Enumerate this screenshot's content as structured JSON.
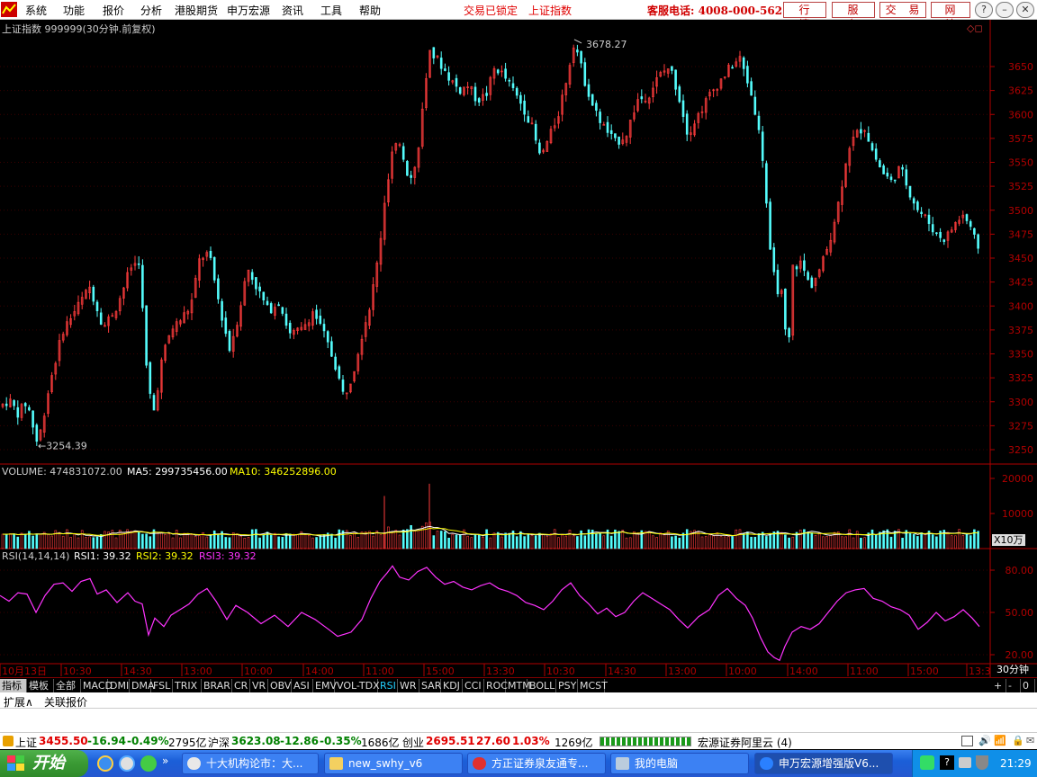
{
  "menu": {
    "items": [
      "系统",
      "功能",
      "报价",
      "分析",
      "港股期货",
      "申万宏源",
      "资讯",
      "工具",
      "帮助"
    ],
    "lock_text": "交易已锁定",
    "index_text": "上证指数",
    "hotline": "客服电话: 4008-000-562",
    "buttons": [
      "行 情",
      "服 务",
      "交 易",
      "网 站"
    ]
  },
  "chart_title": "上证指数 999999(30分钟.前复权)",
  "annotations": {
    "high": "3678.27",
    "low": "3254.39"
  },
  "volume": {
    "label": "VOLUME: 474831072.00",
    "ma5": "MA5: 299735456.00",
    "ma10": "MA10: 346252896.00",
    "unit": "X10万"
  },
  "rsi": {
    "label": "RSI(14,14,14)",
    "rsi1": "RSI1: 39.32",
    "rsi2": "RSI2: 39.32",
    "rsi3": "RSI3: 39.32"
  },
  "period": "30分钟",
  "tabs": [
    "指标",
    "模板",
    "全部",
    "MACD",
    "DMI",
    "DMA",
    "FSL",
    "TRIX",
    "BRAR",
    "CR",
    "VR",
    "OBV",
    "ASI",
    "EMV",
    "VOL-TDX",
    "RSI",
    "WR",
    "SAR",
    "KDJ",
    "CCI",
    "ROC",
    "MTM",
    "BOLL",
    "PSY",
    "MCST"
  ],
  "tab_controls": [
    "+",
    "-",
    "0"
  ],
  "ext_tabs": [
    "扩展∧",
    "关联报价"
  ],
  "status": {
    "sh_label": "上证",
    "sh_val": "3455.50",
    "sh_chg": "-16.94",
    "sh_pct": "-0.49%",
    "sh_amt": "2795亿",
    "hs_label": "沪深",
    "hs_val": "3623.08",
    "hs_chg": "-12.86",
    "hs_pct": "-0.35%",
    "hs_amt": "1686亿",
    "cy_label": "创业",
    "cy_val": "2695.51",
    "cy_chg": "27.60",
    "cy_pct": "1.03%",
    "cy_amt": "1269亿",
    "broker": "宏源证券阿里云 (4)"
  },
  "taskbar": {
    "start": "开始",
    "tasks": [
      "十大机构论市：大...",
      "new_swhy_v6",
      "方正证券泉友通专...",
      "我的电脑",
      "申万宏源增强版V6..."
    ],
    "clock": "21:29"
  },
  "chart_data": {
    "type": "candlestick",
    "title": "上证指数 999999(30分钟.前复权)",
    "x_ticks": [
      "10月13日",
      "10:30",
      "14:30",
      "13:00",
      "10:00",
      "14:00",
      "11:00",
      "15:00",
      "13:30",
      "10:30",
      "14:30",
      "13:00",
      "10:00",
      "14:00",
      "11:00",
      "15:00",
      "13:3"
    ],
    "price_axis": {
      "ticks": [
        3250,
        3275,
        3300,
        3325,
        3350,
        3375,
        3400,
        3425,
        3450,
        3475,
        3500,
        3525,
        3550,
        3575,
        3600,
        3625,
        3650
      ],
      "range": [
        3235,
        3685
      ]
    },
    "volume_axis": {
      "ticks": [
        10000,
        20000
      ],
      "unit": "X10万"
    },
    "rsi_axis": {
      "ticks": [
        20.0,
        50.0,
        80.0
      ]
    },
    "price_path": [
      [
        0,
        3295
      ],
      [
        10,
        3302
      ],
      [
        20,
        3288
      ],
      [
        30,
        3300
      ],
      [
        42,
        3254.39
      ],
      [
        55,
        3318
      ],
      [
        70,
        3375
      ],
      [
        85,
        3398
      ],
      [
        100,
        3420
      ],
      [
        115,
        3378
      ],
      [
        130,
        3400
      ],
      [
        145,
        3440
      ],
      [
        155,
        3448
      ],
      [
        162,
        3340
      ],
      [
        170,
        3285
      ],
      [
        180,
        3345
      ],
      [
        190,
        3375
      ],
      [
        200,
        3385
      ],
      [
        212,
        3400
      ],
      [
        222,
        3450
      ],
      [
        232,
        3455
      ],
      [
        245,
        3395
      ],
      [
        255,
        3355
      ],
      [
        265,
        3390
      ],
      [
        275,
        3440
      ],
      [
        285,
        3420
      ],
      [
        298,
        3395
      ],
      [
        310,
        3405
      ],
      [
        322,
        3370
      ],
      [
        335,
        3375
      ],
      [
        348,
        3395
      ],
      [
        360,
        3370
      ],
      [
        372,
        3340
      ],
      [
        382,
        3305
      ],
      [
        392,
        3330
      ],
      [
        402,
        3370
      ],
      [
        412,
        3405
      ],
      [
        420,
        3450
      ],
      [
        428,
        3510
      ],
      [
        436,
        3560
      ],
      [
        444,
        3570
      ],
      [
        454,
        3535
      ],
      [
        462,
        3545
      ],
      [
        470,
        3610
      ],
      [
        478,
        3665
      ],
      [
        488,
        3655
      ],
      [
        498,
        3640
      ],
      [
        510,
        3625
      ],
      [
        520,
        3630
      ],
      [
        530,
        3615
      ],
      [
        540,
        3620
      ],
      [
        550,
        3650
      ],
      [
        560,
        3640
      ],
      [
        570,
        3625
      ],
      [
        580,
        3610
      ],
      [
        590,
        3590
      ],
      [
        600,
        3555
      ],
      [
        610,
        3575
      ],
      [
        620,
        3600
      ],
      [
        630,
        3640
      ],
      [
        638,
        3678.27
      ],
      [
        648,
        3640
      ],
      [
        660,
        3605
      ],
      [
        672,
        3585
      ],
      [
        684,
        3570
      ],
      [
        696,
        3580
      ],
      [
        708,
        3615
      ],
      [
        720,
        3620
      ],
      [
        732,
        3640
      ],
      [
        744,
        3650
      ],
      [
        754,
        3620
      ],
      [
        764,
        3580
      ],
      [
        776,
        3600
      ],
      [
        788,
        3620
      ],
      [
        800,
        3635
      ],
      [
        812,
        3650
      ],
      [
        822,
        3658
      ],
      [
        832,
        3630
      ],
      [
        840,
        3600
      ],
      [
        848,
        3550
      ],
      [
        856,
        3450
      ],
      [
        862,
        3420
      ],
      [
        870,
        3410
      ],
      [
        875,
        3330
      ],
      [
        880,
        3440
      ],
      [
        890,
        3445
      ],
      [
        900,
        3420
      ],
      [
        912,
        3440
      ],
      [
        922,
        3470
      ],
      [
        932,
        3510
      ],
      [
        942,
        3565
      ],
      [
        952,
        3580
      ],
      [
        960,
        3588
      ],
      [
        970,
        3560
      ],
      [
        980,
        3540
      ],
      [
        990,
        3530
      ],
      [
        1000,
        3545
      ],
      [
        1010,
        3520
      ],
      [
        1020,
        3500
      ],
      [
        1030,
        3490
      ],
      [
        1040,
        3475
      ],
      [
        1050,
        3470
      ],
      [
        1060,
        3485
      ],
      [
        1070,
        3495
      ],
      [
        1080,
        3480
      ],
      [
        1088,
        3450
      ]
    ],
    "rsi_path": [
      [
        0,
        62
      ],
      [
        10,
        58
      ],
      [
        20,
        64
      ],
      [
        30,
        63
      ],
      [
        40,
        50
      ],
      [
        50,
        62
      ],
      [
        60,
        70
      ],
      [
        70,
        71
      ],
      [
        80,
        65
      ],
      [
        90,
        72
      ],
      [
        100,
        74
      ],
      [
        108,
        63
      ],
      [
        118,
        66
      ],
      [
        130,
        57
      ],
      [
        142,
        64
      ],
      [
        150,
        58
      ],
      [
        158,
        56
      ],
      [
        165,
        34
      ],
      [
        172,
        46
      ],
      [
        182,
        40
      ],
      [
        190,
        48
      ],
      [
        200,
        52
      ],
      [
        210,
        56
      ],
      [
        220,
        63
      ],
      [
        230,
        67
      ],
      [
        240,
        58
      ],
      [
        252,
        45
      ],
      [
        262,
        55
      ],
      [
        275,
        50
      ],
      [
        290,
        42
      ],
      [
        305,
        48
      ],
      [
        320,
        40
      ],
      [
        335,
        50
      ],
      [
        350,
        45
      ],
      [
        365,
        38
      ],
      [
        375,
        33
      ],
      [
        390,
        36
      ],
      [
        402,
        45
      ],
      [
        412,
        60
      ],
      [
        422,
        72
      ],
      [
        430,
        78
      ],
      [
        436,
        83
      ],
      [
        444,
        75
      ],
      [
        454,
        73
      ],
      [
        464,
        79
      ],
      [
        474,
        82
      ],
      [
        484,
        75
      ],
      [
        494,
        70
      ],
      [
        504,
        72
      ],
      [
        514,
        68
      ],
      [
        524,
        66
      ],
      [
        534,
        69
      ],
      [
        544,
        71
      ],
      [
        554,
        67
      ],
      [
        564,
        65
      ],
      [
        574,
        62
      ],
      [
        584,
        57
      ],
      [
        594,
        55
      ],
      [
        604,
        52
      ],
      [
        614,
        58
      ],
      [
        624,
        66
      ],
      [
        634,
        71
      ],
      [
        644,
        62
      ],
      [
        654,
        56
      ],
      [
        664,
        49
      ],
      [
        674,
        53
      ],
      [
        684,
        47
      ],
      [
        694,
        50
      ],
      [
        704,
        58
      ],
      [
        714,
        64
      ],
      [
        724,
        60
      ],
      [
        734,
        56
      ],
      [
        744,
        52
      ],
      [
        754,
        45
      ],
      [
        764,
        39
      ],
      [
        776,
        47
      ],
      [
        788,
        52
      ],
      [
        798,
        62
      ],
      [
        808,
        67
      ],
      [
        818,
        60
      ],
      [
        828,
        55
      ],
      [
        836,
        46
      ],
      [
        845,
        32
      ],
      [
        853,
        22
      ],
      [
        860,
        18
      ],
      [
        866,
        16
      ],
      [
        872,
        26
      ],
      [
        880,
        36
      ],
      [
        890,
        40
      ],
      [
        900,
        38
      ],
      [
        910,
        42
      ],
      [
        920,
        50
      ],
      [
        930,
        58
      ],
      [
        940,
        64
      ],
      [
        950,
        66
      ],
      [
        960,
        67
      ],
      [
        970,
        60
      ],
      [
        980,
        58
      ],
      [
        990,
        54
      ],
      [
        1000,
        52
      ],
      [
        1010,
        48
      ],
      [
        1020,
        38
      ],
      [
        1030,
        43
      ],
      [
        1040,
        50
      ],
      [
        1050,
        44
      ],
      [
        1060,
        47
      ],
      [
        1070,
        52
      ],
      [
        1080,
        46
      ],
      [
        1088,
        40
      ]
    ]
  },
  "colors": {
    "up": "#ff3c3c",
    "down": "#54fcfc",
    "axis": "#b00000",
    "ma5": "#ffffff",
    "ma10": "#ffff00",
    "rsi_line": "#ff33ff"
  }
}
